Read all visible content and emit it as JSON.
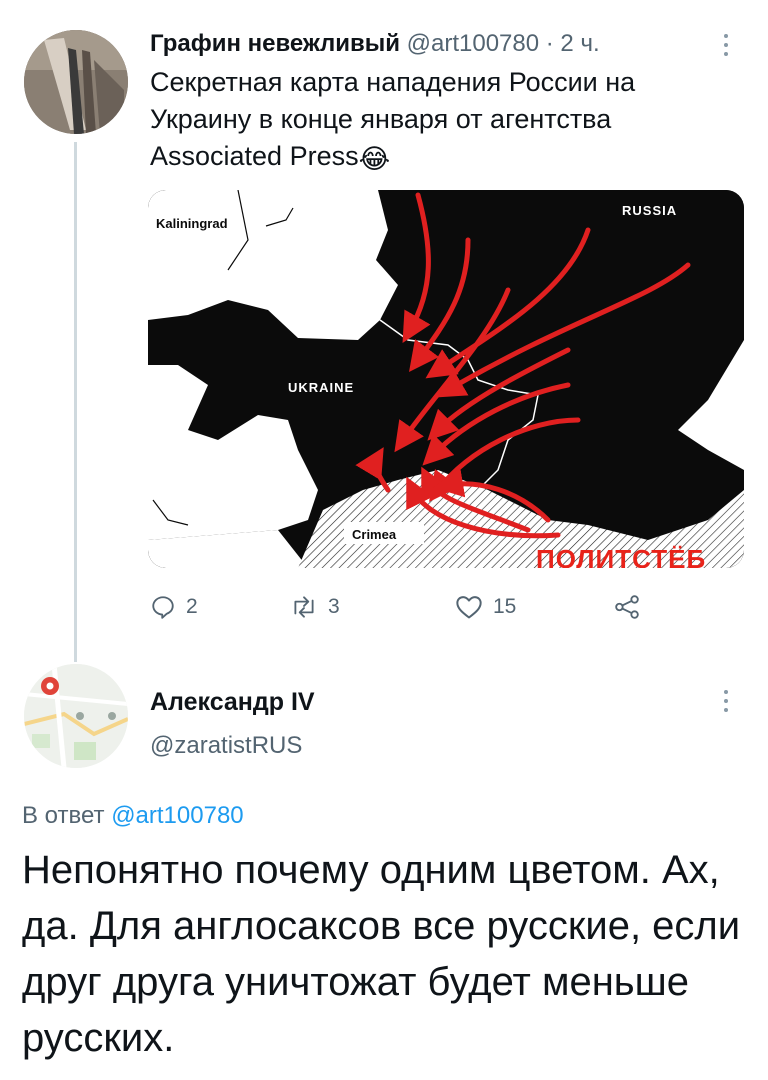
{
  "tweet": {
    "author_name": "Графин невежливый",
    "author_handle": "@art100780",
    "separator": " · ",
    "time": "2 ч.",
    "text": "Секретная карта нападения России на Украину в конце января от агентства Associated Press",
    "emoji": "😂",
    "map": {
      "labels": {
        "kaliningrad": "Kaliningrad",
        "russia": "RUSSIA",
        "ukraine": "UKRAINE",
        "crimea": "Crimea"
      },
      "watermark": "ПОЛИТСТЁБ",
      "colors": {
        "land": "#0b0b0b",
        "neighbors": "#ffffff",
        "arrows": "#e02020",
        "watermark": "#e8231a"
      }
    },
    "actions": {
      "replies": "2",
      "retweets": "3",
      "likes": "15"
    }
  },
  "reply": {
    "author_name": "Александр IV",
    "author_handle": "@zaratistRUS",
    "reply_prefix": "В ответ",
    "reply_to": "@art100780",
    "text": "Непонятно почему одним цветом. Ах, да. Для англосаксов все русские, если друг друга уничтожат будет меньше русских."
  }
}
